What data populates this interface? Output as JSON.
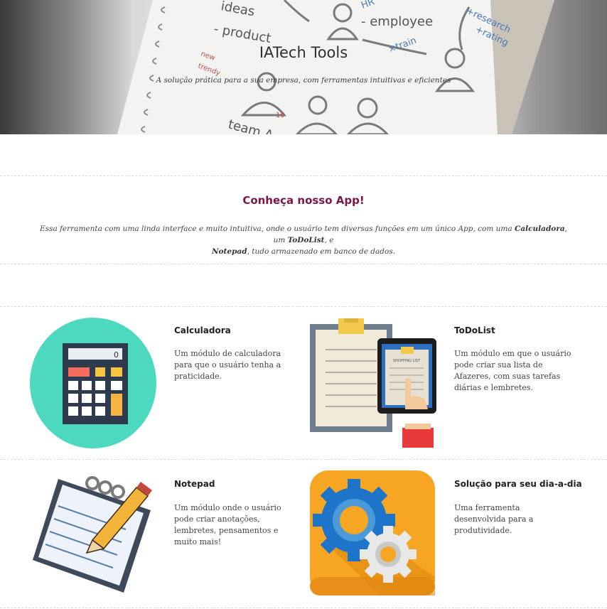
{
  "hero": {
    "title": "IATech Tools",
    "subtitle": "A solução prática para a sua empresa, com  ferramentas intuitivas e eficientes"
  },
  "intro": {
    "heading": "Conheça nosso App!",
    "text_before": "Essa ferramenta com uma linda interface e muito intuitiva, onde o usuário tem diversas funções em um único App, com uma ",
    "calc": "Calculadora",
    "sep1": ", um ",
    "todo": "ToDoList",
    "sep2": ", e",
    "notepad": "Notepad",
    "text_after": ", tudo armazenado em banco de dados."
  },
  "features": {
    "calculator": {
      "title": "Calculadora",
      "desc": "Um módulo de calculadora para que o usuário tenha a praticidade.",
      "display": "0"
    },
    "todolist": {
      "title": "ToDoList",
      "desc": "Um módulo em que o usuário pode criar sua lista de Afazeres, com suas tarefas diárias e lembretes.",
      "tablet_label": "SHOPPING LIST"
    },
    "notepad": {
      "title": "Notepad",
      "desc": "Um módulo onde o usuário pode criar anotações, lembretes, pensamentos e muito mais!"
    },
    "solution": {
      "title": "Solução para seu dia-a-dia",
      "desc": "Uma ferramenta desenvolvida para a produtividade."
    }
  },
  "colors": {
    "heading_accent": "#7a1748",
    "calc_circle": "#4dd9c0",
    "gear_tile": "#f6a623",
    "gear_blue": "#1e74c9"
  },
  "icons": [
    "calculator-icon",
    "clipboard-tablet-icon",
    "notepad-pencil-icon",
    "gears-icon"
  ]
}
